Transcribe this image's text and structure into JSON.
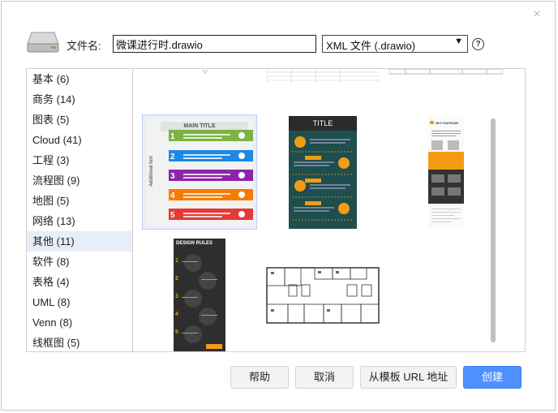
{
  "dialog": {
    "filename_label": "文件名:",
    "filename_value": "微课进行时.drawio",
    "file_type": "XML 文件 (.drawio)",
    "close_glyph": "×",
    "help_glyph": "?"
  },
  "categories": [
    {
      "label": "基本 (6)"
    },
    {
      "label": "商务 (14)"
    },
    {
      "label": "图表 (5)"
    },
    {
      "label": "Cloud (41)"
    },
    {
      "label": "工程 (3)"
    },
    {
      "label": "流程图 (9)"
    },
    {
      "label": "地图 (5)"
    },
    {
      "label": "网络 (13)"
    },
    {
      "label": "其他 (11)"
    },
    {
      "label": "软件 (8)"
    },
    {
      "label": "表格 (4)"
    },
    {
      "label": "UML (8)"
    },
    {
      "label": "Venn (8)"
    },
    {
      "label": "线框图 (5)"
    }
  ],
  "selected_category": "其他 (11)",
  "templates": {
    "infographic": {
      "title": "MAIN TITLE",
      "side_text": "Additional text",
      "steps": [
        "1",
        "2",
        "3",
        "4",
        "5"
      ],
      "colors": [
        "#7cb342",
        "#1e88e5",
        "#8e24aa",
        "#f57c00",
        "#e53935"
      ]
    },
    "poster": {
      "title": "TITLE",
      "bg": "#1f4e4f",
      "accent": "#f39c12"
    },
    "article": {
      "title": "WHY DIAGRAMS"
    },
    "design_rules": {
      "title": "DESIGN RULES",
      "steps": [
        "1",
        "2",
        "3",
        "4",
        "5"
      ]
    }
  },
  "buttons": {
    "help": "帮助",
    "cancel": "取消",
    "from_url": "从模板 URL 地址",
    "create": "创建"
  }
}
